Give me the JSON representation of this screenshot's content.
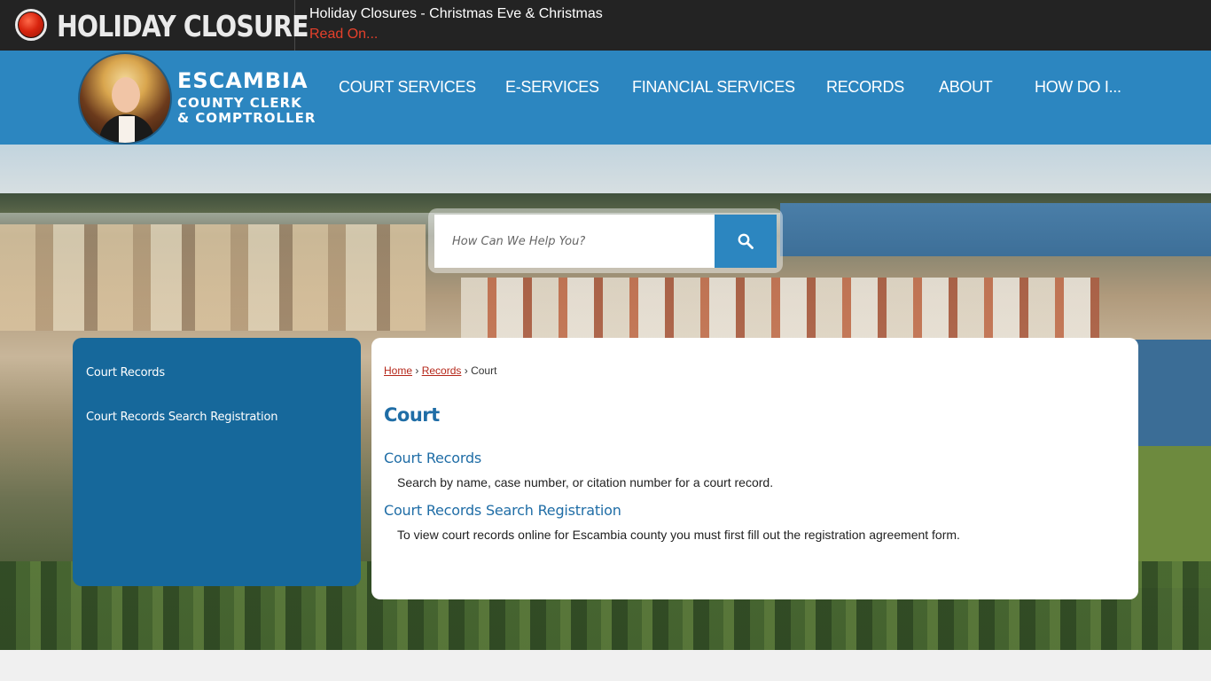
{
  "alert": {
    "title": "HOLIDAY CLOSURE",
    "message": "Holiday Closures - Christmas Eve & Christmas",
    "link": "Read On..."
  },
  "header": {
    "logo": {
      "line1": "ESCAMBIA",
      "line2": "COUNTY CLERK",
      "line3": "& COMPTROLLER"
    },
    "nav": [
      {
        "label": "COURT SERVICES"
      },
      {
        "label": "E-SERVICES"
      },
      {
        "label": "FINANCIAL SERVICES"
      },
      {
        "label": "RECORDS"
      },
      {
        "label": "ABOUT"
      },
      {
        "label": "HOW DO I..."
      }
    ]
  },
  "search": {
    "placeholder": "How Can We Help You?",
    "icon": "search-icon"
  },
  "sidebar": {
    "items": [
      {
        "label": "Court Records"
      },
      {
        "label": "Court Records Search Registration"
      }
    ]
  },
  "breadcrumb": {
    "home": "Home",
    "records": "Records",
    "separator": "›",
    "current": "Court"
  },
  "main": {
    "title": "Court",
    "sections": [
      {
        "title": "Court Records",
        "description": "Search by name, case number, or citation number for a court record."
      },
      {
        "title": "Court Records Search Registration",
        "description": "To view court records online for Escambia county you must first fill out the registration agreement form."
      }
    ]
  },
  "colors": {
    "header_blue": "#2c86c0",
    "sidebar_blue": "#16689b",
    "title_blue": "#1f6da6",
    "alert_red": "#e6402b",
    "alert_bar": "#232323"
  }
}
